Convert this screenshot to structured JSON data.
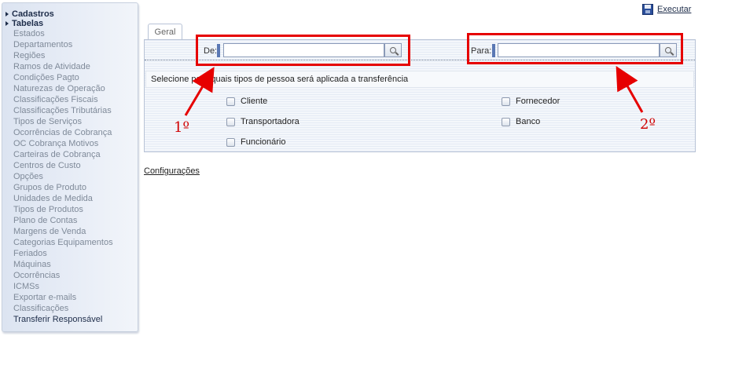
{
  "sidebar": {
    "sections": [
      {
        "label": "Cadastros"
      },
      {
        "label": "Tabelas"
      }
    ],
    "items": [
      "Estados",
      "Departamentos",
      "Regiões",
      "Ramos de Atividade",
      "Condições Pagto",
      "Naturezas de Operação",
      "Classificações Fiscais",
      "Classificações Tributárias",
      "Tipos de Serviços",
      "Ocorrências de Cobrança",
      "OC Cobrança Motivos",
      "Carteiras de Cobrança",
      "Centros de Custo",
      "Opções",
      "Grupos de Produto",
      "Unidades de Medida",
      "Tipos de Produtos",
      "Plano de Contas",
      "Margens de Venda",
      "Categorias Equipamentos",
      "Feriados",
      "Máquinas",
      "Ocorrências",
      "ICMSs",
      "Exportar e-mails",
      "Classificações",
      "Transferir Responsável"
    ]
  },
  "toolbar": {
    "execute_label": "Executar"
  },
  "tabs": [
    {
      "label": "Geral"
    }
  ],
  "form": {
    "from_label": "De:",
    "from_value": "",
    "to_label": "Para:",
    "to_value": "",
    "info_text": "Selecione para quais tipos de pessoa será aplicada a transferência",
    "checkboxes": [
      {
        "label": "Cliente",
        "checked": false
      },
      {
        "label": "Fornecedor",
        "checked": false
      },
      {
        "label": "Transportadora",
        "checked": false
      },
      {
        "label": "Banco",
        "checked": false
      },
      {
        "label": "Funcionário",
        "checked": false
      }
    ]
  },
  "links": {
    "config_label": "Configurações"
  },
  "annotations": {
    "first_label": "1º",
    "second_label": "2º",
    "color": "#e60000"
  }
}
